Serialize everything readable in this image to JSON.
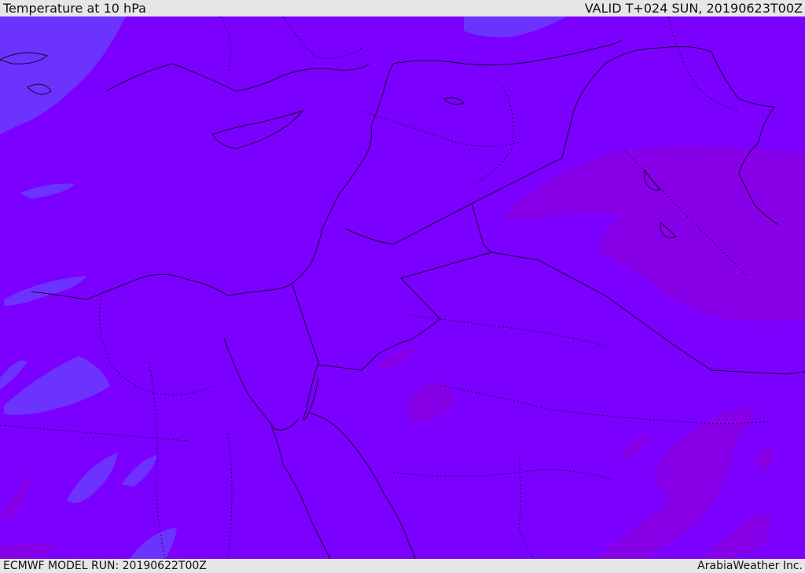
{
  "header": {
    "title": "Temperature at 10 hPa",
    "valid": "VALID T+024 SUN, 20190623T00Z"
  },
  "footer": {
    "model_run": "ECMWF MODEL RUN: 20190622T00Z",
    "credit": "ArabiaWeather Inc."
  },
  "map": {
    "base_fill": "#7b00ff",
    "cool_fill": "#6a3cff",
    "warm_fill": "#8a00e6",
    "coast_color": "#1a0033",
    "border_style": "dotted"
  }
}
